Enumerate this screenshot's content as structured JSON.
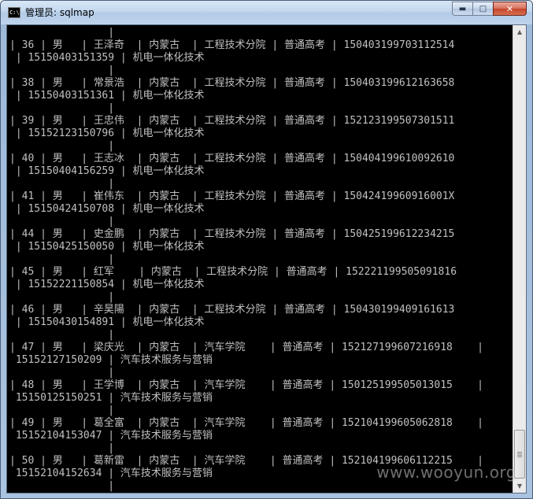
{
  "window": {
    "title": "管理员: sqlmap",
    "icon_glyph": "C:\\",
    "minimize_glyph": "▬",
    "maximize_glyph": "□",
    "close_glyph": "✕"
  },
  "console": {
    "lines": [
      "                |",
      "| 36 | 男   | 王泽奇  | 内蒙古  | 工程技术分院 | 普通高考 | 150403199703112514",
      " | 15150403151359 | 机电一体化技术",
      "                |",
      "| 38 | 男   | 常景浩  | 内蒙古  | 工程技术分院 | 普通高考 | 150403199612163658",
      " | 15150403151361 | 机电一体化技术",
      "                |",
      "| 39 | 男   | 王忠伟  | 内蒙古  | 工程技术分院 | 普通高考 | 152123199507301511",
      " | 15152123150796 | 机电一体化技术",
      "                |",
      "| 40 | 男   | 王志冰  | 内蒙古  | 工程技术分院 | 普通高考 | 150404199610092610",
      " | 15150404156259 | 机电一体化技术",
      "                |",
      "| 41 | 男   | 崔伟东  | 内蒙古  | 工程技术分院 | 普通高考 | 15042419960916001X",
      " | 15150424150708 | 机电一体化技术",
      "                |",
      "| 44 | 男   | 史金鹏  | 内蒙古  | 工程技术分院 | 普通高考 | 150425199612234215",
      " | 15150425150050 | 机电一体化技术",
      "                |",
      "| 45 | 男   | 红军    | 内蒙古  | 工程技术分院 | 普通高考 | 152221199505091816",
      " | 15152221150854 | 机电一体化技术",
      "                |",
      "| 46 | 男   | 辛昊陽  | 内蒙古  | 工程技术分院 | 普通高考 | 150430199409161613",
      " | 15150430154891 | 机电一体化技术",
      "                |",
      "| 47 | 男   | 梁庆光  | 内蒙古  | 汽车学院    | 普通高考 | 152127199607216918    |",
      " 15152127150209 | 汽车技术服务与营销",
      "                |",
      "| 48 | 男   | 王学博  | 内蒙古  | 汽车学院    | 普通高考 | 150125199505013015    |",
      " 15150125150251 | 汽车技术服务与营销",
      "                |",
      "| 49 | 男   | 葛全富  | 内蒙古  | 汽车学院    | 普通高考 | 152104199605062818    |",
      " 15152104153047 | 汽车技术服务与营销",
      "                |",
      "| 50 | 男   | 葛新雷  | 内蒙古  | 汽车学院    | 普通高考 | 152104199606112215    |",
      " 15152104152634 | 汽车技术服务与营销",
      "                |"
    ]
  },
  "scrollbar": {
    "up_glyph": "▲",
    "down_glyph": "▼"
  },
  "watermark": "www.wooyun.org"
}
